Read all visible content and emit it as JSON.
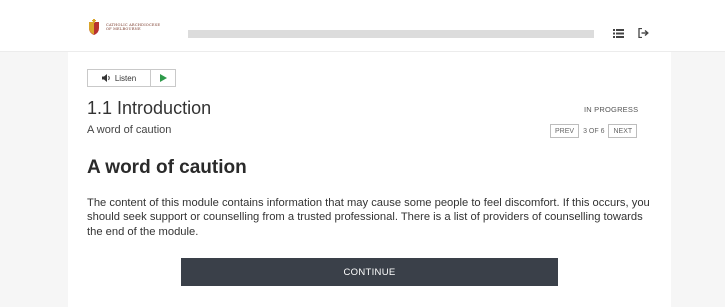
{
  "header": {
    "org_name_line1": "CATHOLIC ARCHDIOCESE",
    "org_name_line2": "OF MELBOURNE",
    "progress": 0,
    "menu_icon": "list-icon",
    "exit_icon": "sign-out-icon"
  },
  "audio": {
    "listen_label": "Listen",
    "speaker_icon": "speaker-icon",
    "play_icon": "play-icon"
  },
  "section": {
    "title": "1.1 Introduction",
    "subtitle": "A word of caution",
    "status": "IN PROGRESS"
  },
  "pager": {
    "prev_label": "PREV",
    "position": "3 OF 6",
    "next_label": "NEXT"
  },
  "content": {
    "heading": "A word of caution",
    "paragraph": "The content of this module contains information that may cause some people to feel discomfort. If this occurs, you should seek support or counselling from a trusted professional. There is a list of providers of counselling towards the end of the module."
  },
  "actions": {
    "continue_label": "CONTINUE"
  },
  "colors": {
    "button_bg": "#3a4049",
    "progress_track": "#dcdcdc",
    "crest_gold": "#d9a52b",
    "crest_red": "#b8312f",
    "play_green": "#2e9a4a"
  }
}
